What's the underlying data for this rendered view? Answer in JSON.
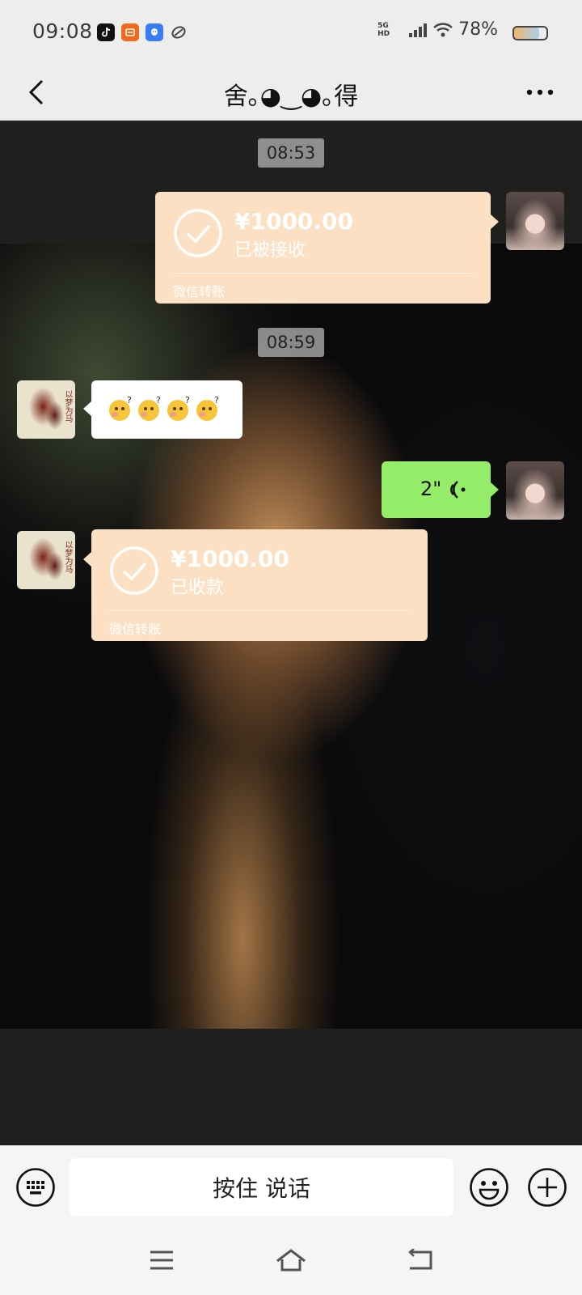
{
  "status_bar": {
    "time": "09:08",
    "network": "5G HD",
    "battery_percent": "78%",
    "battery_level": 0.78,
    "notification_icons": [
      "douyin-icon",
      "taobao-icon",
      "qq-icon",
      "link-icon"
    ]
  },
  "header": {
    "title": "舍｡◕‿◕｡得",
    "back_icon": "chevron-left-icon",
    "more_icon": "more-dots-icon"
  },
  "messages": {
    "timestamp_1": "08:53",
    "transfer_1": {
      "amount": "¥1000.00",
      "status": "已被接收",
      "footer": "微信转账"
    },
    "timestamp_2": "08:59",
    "emoji_message": [
      "puzzled-emoji",
      "puzzled-emoji",
      "puzzled-emoji",
      "puzzled-emoji"
    ],
    "voice": {
      "duration": "2\""
    },
    "transfer_2": {
      "amount": "¥1000.00",
      "status": "已收款",
      "footer": "微信转账"
    },
    "friend_avatar_text": "以梦为马"
  },
  "input_bar": {
    "talk_label": "按住 说话",
    "keyboard_icon": "keyboard-icon",
    "emoji_icon": "smile-icon",
    "plus_icon": "plus-circle-icon"
  },
  "system_nav": {
    "menu_icon": "menu-icon",
    "home_icon": "home-icon",
    "back_icon": "back-return-icon"
  },
  "colors": {
    "transfer_bg": "#fce0c4",
    "voice_bubble": "#95ec69",
    "header_bg": "#ededed"
  }
}
